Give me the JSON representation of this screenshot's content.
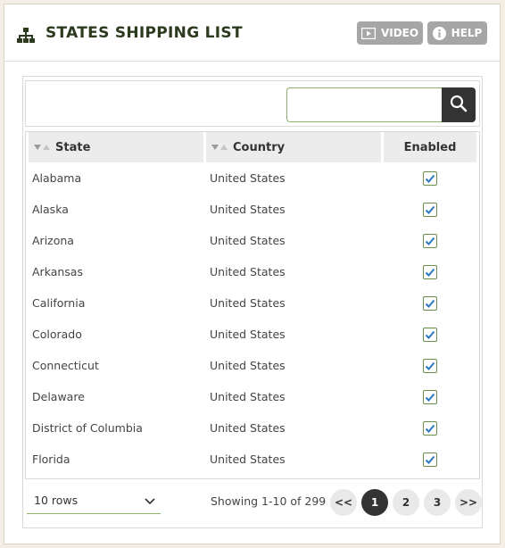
{
  "header": {
    "title": "STATES SHIPPING LIST",
    "icon": "sitemap-icon",
    "video_label": "VIDEO",
    "help_label": "HELP"
  },
  "search": {
    "placeholder": "",
    "value": ""
  },
  "table": {
    "columns": [
      "State",
      "Country",
      "Enabled"
    ],
    "rows": [
      {
        "state": "Alabama",
        "country": "United States",
        "enabled": true
      },
      {
        "state": "Alaska",
        "country": "United States",
        "enabled": true
      },
      {
        "state": "Arizona",
        "country": "United States",
        "enabled": true
      },
      {
        "state": "Arkansas",
        "country": "United States",
        "enabled": true
      },
      {
        "state": "California",
        "country": "United States",
        "enabled": true
      },
      {
        "state": "Colorado",
        "country": "United States",
        "enabled": true
      },
      {
        "state": "Connecticut",
        "country": "United States",
        "enabled": true
      },
      {
        "state": "Delaware",
        "country": "United States",
        "enabled": true
      },
      {
        "state": "District of Columbia",
        "country": "United States",
        "enabled": true
      },
      {
        "state": "Florida",
        "country": "United States",
        "enabled": true
      }
    ]
  },
  "footer": {
    "rows_select": "10 rows",
    "showing": "Showing 1-10 of 299",
    "pagination": {
      "prev": "<<",
      "pages": [
        "1",
        "2",
        "3"
      ],
      "current": "1",
      "next": ">>"
    }
  },
  "colors": {
    "accent_green": "#8cb36a",
    "dark": "#333333",
    "button_gray": "#a6a6a6",
    "check_blue": "#2a78c2"
  }
}
